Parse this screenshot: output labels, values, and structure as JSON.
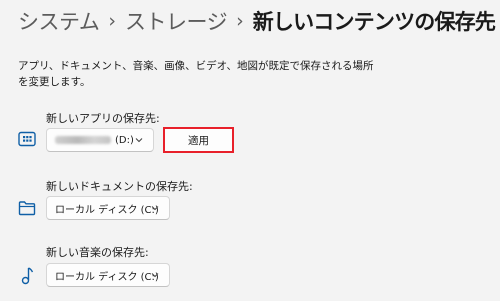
{
  "breadcrumb": {
    "items": [
      "システム",
      "ストレージ"
    ],
    "separator": "›",
    "current": "新しいコンテンツの保存先"
  },
  "description": "アプリ、ドキュメント、音楽、画像、ビデオ、地図が既定で保存される場所を変更します。",
  "settings": [
    {
      "label": "新しいアプリの保存先:",
      "value": "(D:)",
      "icon": "app-drive-icon"
    },
    {
      "label": "新しいドキュメントの保存先:",
      "value": "ローカル ディスク (C:)",
      "icon": "folder-icon"
    },
    {
      "label": "新しい音楽の保存先:",
      "value": "ローカル ディスク (C:)",
      "icon": "music-note-icon"
    }
  ],
  "apply_label": "適用",
  "colors": {
    "accent": "#0f5fa6",
    "highlight": "#e8202a"
  }
}
